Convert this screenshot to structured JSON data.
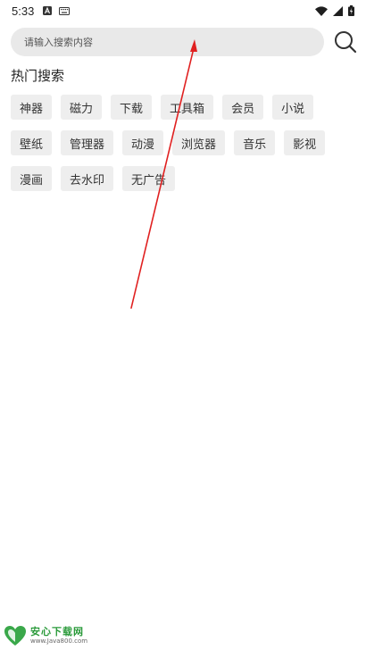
{
  "status_bar": {
    "time": "5:33",
    "icons_left": [
      "text-a-icon",
      "keyboard-icon"
    ],
    "icons_right": [
      "wifi-icon",
      "signal-icon",
      "battery-icon"
    ]
  },
  "search": {
    "placeholder": "请输入搜索内容",
    "button_icon": "search-icon"
  },
  "hot_search": {
    "title": "热门搜索",
    "rows": [
      [
        "神器",
        "磁力",
        "下载",
        "工具箱",
        "会员",
        "小说"
      ],
      [
        "壁纸",
        "管理器",
        "动漫",
        "浏览器",
        "音乐",
        "影视"
      ],
      [
        "漫画",
        "去水印",
        "无广告"
      ]
    ]
  },
  "annotation": {
    "type": "red-arrow",
    "color": "#e02020"
  },
  "watermark": {
    "title": "安心下载网",
    "url": "www.Java800.com",
    "color": "#2a9a3a"
  }
}
